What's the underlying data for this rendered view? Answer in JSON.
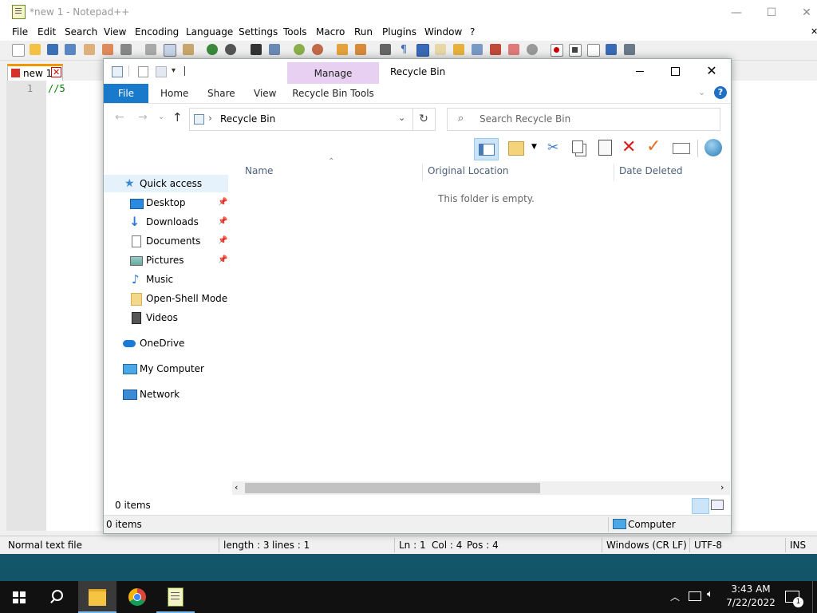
{
  "notepad": {
    "title": "*new 1 - Notepad++",
    "window_buttons": [
      "—",
      "☐",
      "✕"
    ],
    "menu": [
      "File",
      "Edit",
      "Search",
      "View",
      "Encoding",
      "Language",
      "Settings",
      "Tools",
      "Macro",
      "Run",
      "Plugins",
      "Window",
      "?"
    ],
    "close_all": "✕",
    "tab": {
      "label": "new 1",
      "close": "✕"
    },
    "editor": {
      "line_number": "1",
      "content": "//5"
    },
    "status": {
      "file_type": "Normal text file",
      "length": "length : 3",
      "lines": "lines : 1",
      "ln": "Ln : 1",
      "col": "Col : 4",
      "pos": "Pos : 4",
      "eol": "Windows (CR LF)",
      "encoding": "UTF-8",
      "mode": "INS"
    }
  },
  "explorer": {
    "title": "Recycle Bin",
    "context_tab": "Manage",
    "ribbon_tabs": [
      "File",
      "Home",
      "Share",
      "View",
      "Recycle Bin Tools"
    ],
    "help": "?",
    "address": "Recycle Bin",
    "search_placeholder": "Search Recycle Bin",
    "columns": [
      "Name",
      "Original Location",
      "Date Deleted"
    ],
    "empty_message": "This folder is empty.",
    "nav": {
      "quick_access": "Quick access",
      "items": [
        "Desktop",
        "Downloads",
        "Documents",
        "Pictures",
        "Music",
        "Open-Shell Modern",
        "Videos"
      ],
      "onedrive": "OneDrive",
      "computer": "My Computer",
      "network": "Network"
    },
    "status_items": "0 items",
    "status_items2": "0 items",
    "status_location": "Computer"
  },
  "taskbar": {
    "time": "3:43 AM",
    "date": "7/22/2022",
    "notifications": "1"
  }
}
